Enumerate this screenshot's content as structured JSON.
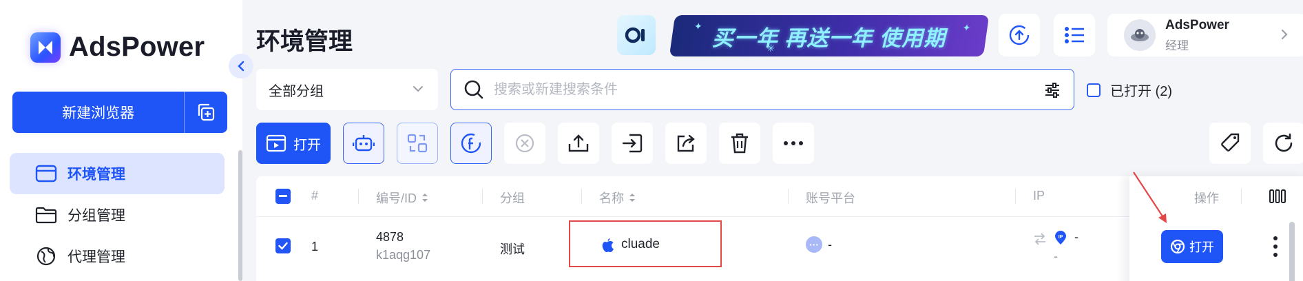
{
  "brand": {
    "name": "AdsPower"
  },
  "sidebar": {
    "new_browser_label": "新建浏览器",
    "items": [
      {
        "label": "环境管理",
        "active": true,
        "icon": "window-icon"
      },
      {
        "label": "分组管理",
        "active": false,
        "icon": "folder-icon"
      },
      {
        "label": "代理管理",
        "active": false,
        "icon": "globe-icon"
      }
    ]
  },
  "header": {
    "title": "环境管理",
    "banner_text": "买一年 再送一年 使用期",
    "user": {
      "name": "AdsPower",
      "role": "经理"
    }
  },
  "filters": {
    "group_select": "全部分组",
    "search_placeholder": "搜索或新建搜索条件",
    "opened_label": "已打开 (2)"
  },
  "toolbar": {
    "open_label": "打开"
  },
  "table": {
    "headers": {
      "index": "#",
      "id": "编号/ID",
      "group": "分组",
      "name": "名称",
      "platform": "账号平台",
      "ip": "IP",
      "actions": "操作"
    },
    "rows": [
      {
        "index": "1",
        "serial": "4878",
        "id": "k1aqg107",
        "group": "测试",
        "name": "cluade",
        "platform": "-",
        "ip": "-",
        "ip_sub": "-",
        "open_label": "打开"
      }
    ]
  },
  "colors": {
    "accent": "#1f55f6",
    "highlight": "#e34848"
  }
}
